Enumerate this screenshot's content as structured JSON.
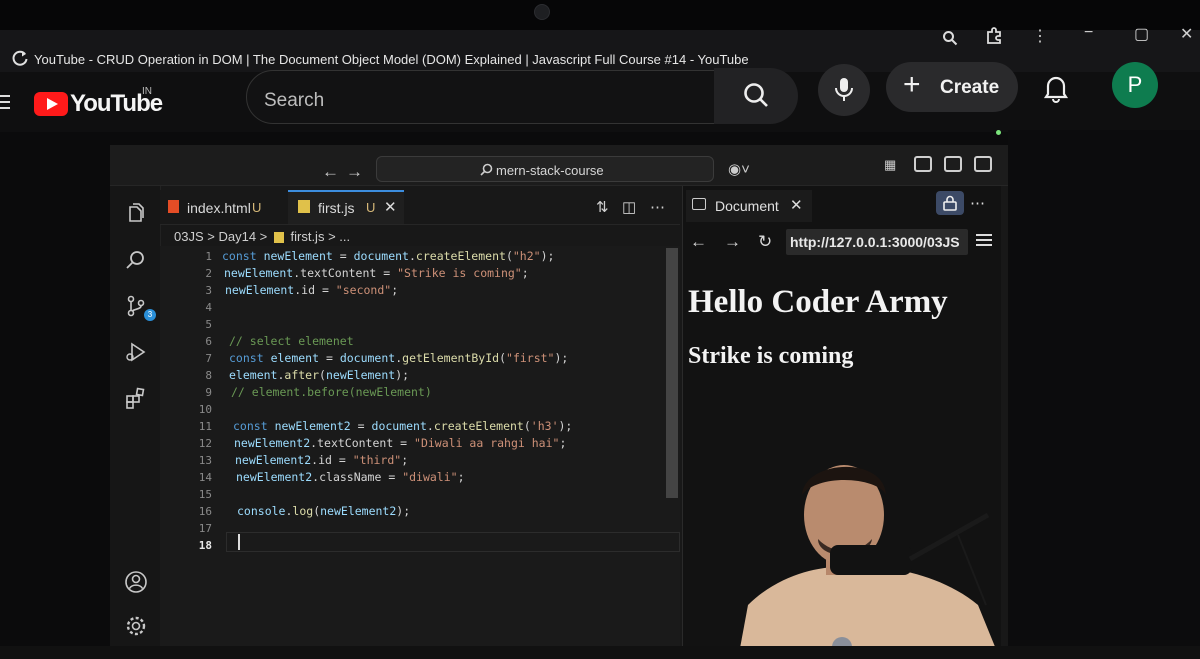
{
  "browser": {
    "page_title": "YouTube - CRUD Operation in DOM | The Document Object Model (DOM) Explained | Javascript Full Course #14 - YouTube",
    "window_buttons": [
      "−",
      "▢",
      "✕"
    ]
  },
  "youtube": {
    "logo_text": "YouTube",
    "country_code": "IN",
    "search_placeholder": "Search",
    "create_label": "Create",
    "avatar_letter": "P",
    "brand_color": "#ff1a1a"
  },
  "vscode": {
    "command_center": "mern-stack-course",
    "tabs": [
      {
        "label": "index.html",
        "status": "U",
        "icon": "html5-icon"
      },
      {
        "label": "first.js",
        "status": "U",
        "icon": "js-file-icon",
        "active": true
      }
    ],
    "breadcrumb": [
      "03JS",
      "Day14",
      "first.js",
      "..."
    ],
    "scm_badge": "3",
    "code_lines": [
      {
        "n": "1",
        "text": "const newElement = document.createElement(\"h2\");"
      },
      {
        "n": "2",
        "text": "newElement.textContent = \"Strike is coming\";"
      },
      {
        "n": "3",
        "text": "newElement.id = \"second\";"
      },
      {
        "n": "4",
        "text": ""
      },
      {
        "n": "5",
        "text": ""
      },
      {
        "n": "6",
        "text": "// select elemenet"
      },
      {
        "n": "7",
        "text": "const element = document.getElementById(\"first\");"
      },
      {
        "n": "8",
        "text": "element.after(newElement);"
      },
      {
        "n": "9",
        "text": "// element.before(newElement)"
      },
      {
        "n": "10",
        "text": ""
      },
      {
        "n": "11",
        "text": "const newElement2 = document.createElement('h3');"
      },
      {
        "n": "12",
        "text": "newElement2.textContent = \"Diwali aa rahgi hai\";"
      },
      {
        "n": "13",
        "text": "newElement2.id = \"third\";"
      },
      {
        "n": "14",
        "text": "newElement2.className = \"diwali\";"
      },
      {
        "n": "15",
        "text": ""
      },
      {
        "n": "16",
        "text": "console.log(newElement2);"
      },
      {
        "n": "17",
        "text": ""
      },
      {
        "n": "18",
        "text": ""
      }
    ]
  },
  "preview": {
    "tab_label": "Document",
    "url": "http://127.0.0.1:3000/03JS",
    "h2": "Hello Coder Army",
    "h3": "Strike is coming"
  }
}
